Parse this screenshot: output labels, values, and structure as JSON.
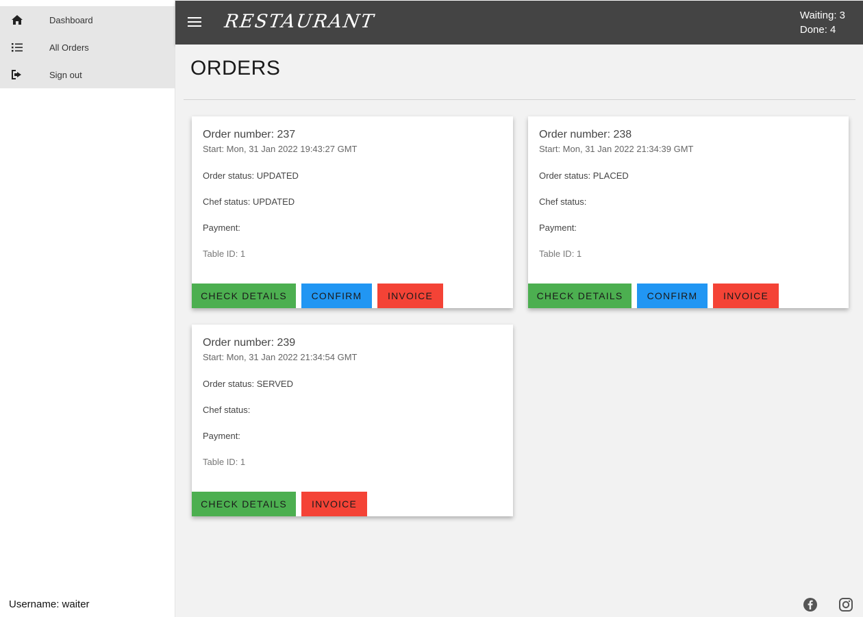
{
  "sidebar": {
    "items": [
      {
        "label": "Dashboard",
        "icon": "home-icon"
      },
      {
        "label": "All Orders",
        "icon": "list-icon"
      },
      {
        "label": "Sign out",
        "icon": "sign-out-icon"
      }
    ],
    "username": "Username: waiter"
  },
  "header": {
    "brand": "RESTAURANT",
    "waiting": "Waiting: 3",
    "done": "Done: 4"
  },
  "main": {
    "title": "ORDERS",
    "orders": [
      {
        "number": "Order number: 237",
        "start": "Start: Mon, 31 Jan 2022 19:43:27 GMT",
        "order_status": "Order status: UPDATED",
        "chef_status": "Chef status: UPDATED",
        "payment": "Payment:",
        "table": "Table ID: 1",
        "buttons": [
          "CHECK DETAILS",
          "CONFIRM",
          "INVOICE"
        ]
      },
      {
        "number": "Order number: 238",
        "start": "Start: Mon, 31 Jan 2022 21:34:39 GMT",
        "order_status": "Order status: PLACED",
        "chef_status": "Chef status:",
        "payment": "Payment:",
        "table": "Table ID: 1",
        "buttons": [
          "CHECK DETAILS",
          "CONFIRM",
          "INVOICE"
        ]
      },
      {
        "number": "Order number: 239",
        "start": "Start: Mon, 31 Jan 2022 21:34:54 GMT",
        "order_status": "Order status: SERVED",
        "chef_status": "Chef status:",
        "payment": "Payment:",
        "table": "Table ID: 1",
        "buttons": [
          "CHECK DETAILS",
          "INVOICE"
        ]
      }
    ]
  },
  "footer": {
    "icons": [
      "facebook-icon",
      "instagram-icon"
    ]
  },
  "colors": {
    "header_bg": "#444444",
    "button_green": "#4caf50",
    "button_blue": "#2196f3",
    "button_red": "#f44336"
  }
}
